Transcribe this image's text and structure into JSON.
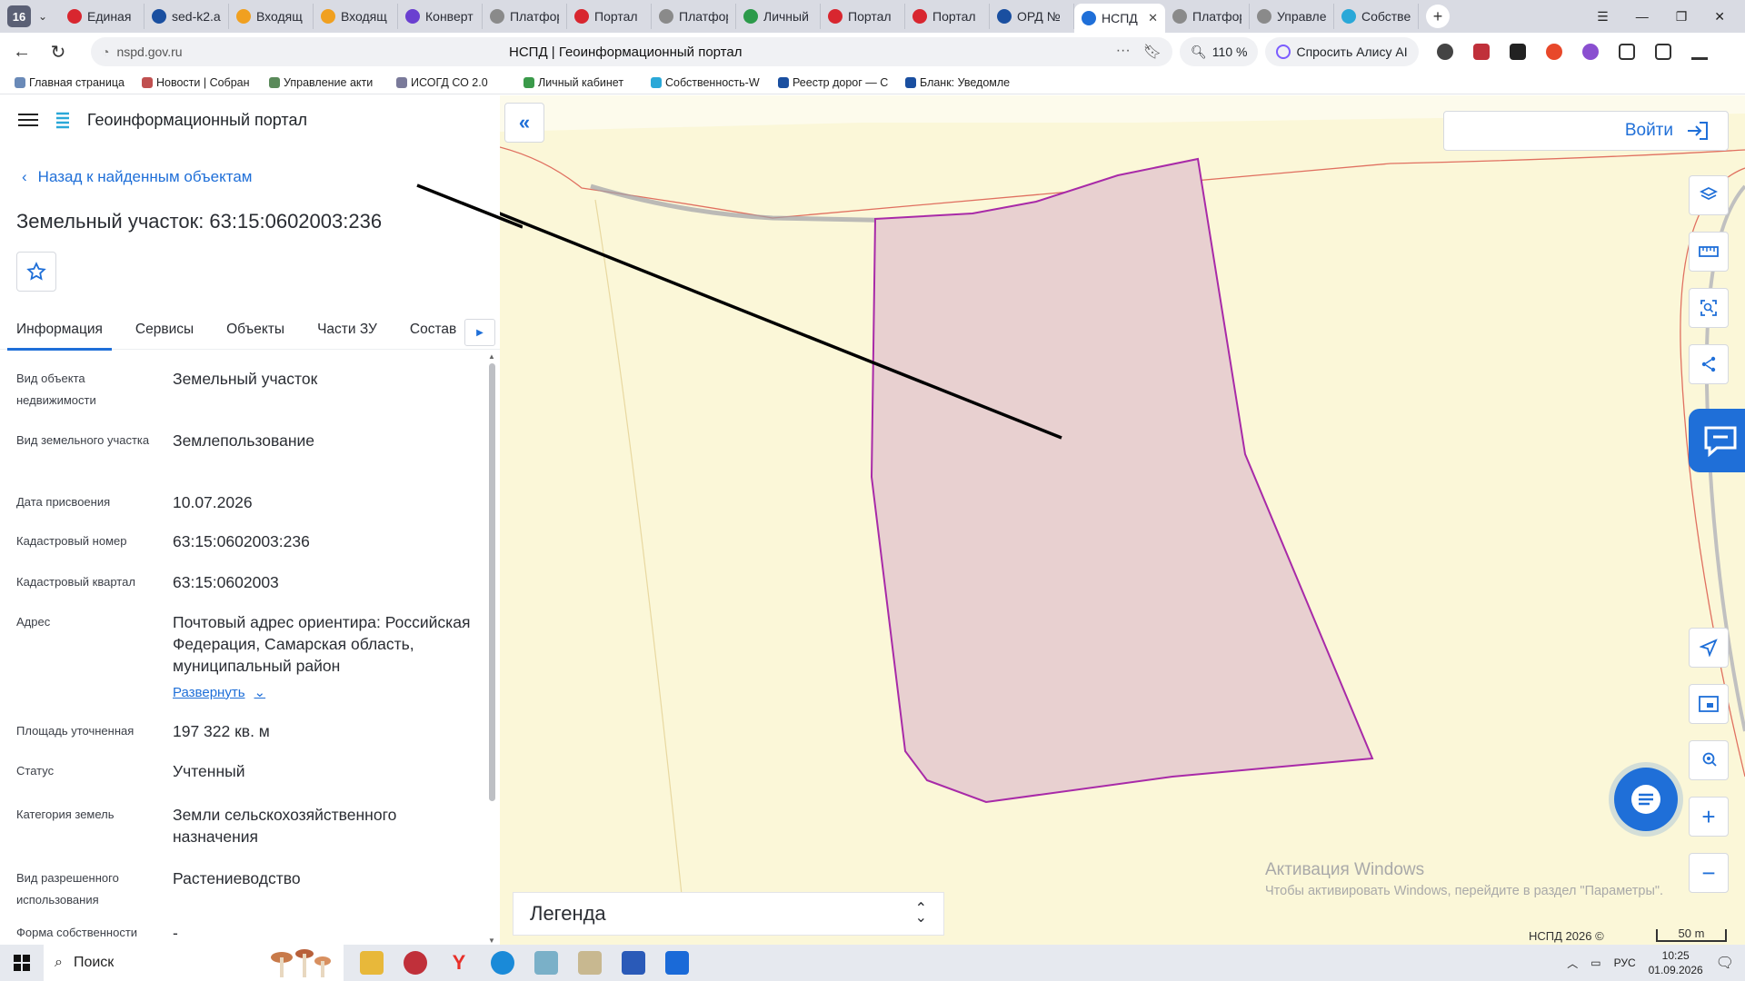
{
  "browser": {
    "tab_count": "16",
    "tabs": [
      {
        "label": "Единая",
        "color": "#d8262f"
      },
      {
        "label": "sed-k2.a",
        "color": "#1a4fa0"
      },
      {
        "label": "Входящ",
        "color": "#f0a020"
      },
      {
        "label": "Входящ",
        "color": "#f0a020"
      },
      {
        "label": "Конверт",
        "color": "#6a3fd0"
      },
      {
        "label": "Платфор",
        "color": "#8a8a8a"
      },
      {
        "label": "Портал",
        "color": "#d8262f"
      },
      {
        "label": "Платфор",
        "color": "#8a8a8a"
      },
      {
        "label": "Личный",
        "color": "#2c9a4a"
      },
      {
        "label": "Портал",
        "color": "#d8262f"
      },
      {
        "label": "Портал",
        "color": "#d8262f"
      },
      {
        "label": "ОРД №",
        "color": "#1a4fa0"
      },
      {
        "label": "НСПД",
        "color": "#1f6fd8",
        "active": true
      },
      {
        "label": "Платфор",
        "color": "#8a8a8a"
      },
      {
        "label": "Управле",
        "color": "#8a8a8a"
      },
      {
        "label": "Собстве",
        "color": "#2aa8d8"
      }
    ],
    "url": "nspd.gov.ru",
    "page_title": "НСПД | Геоинформационный портал",
    "zoom": "110 %",
    "alice_label": "Спросить Алису AI",
    "bookmarks": [
      "Главная страница",
      "Новости | Собран",
      "Управление акти",
      "ИСОГД СО 2.0",
      "Личный кабинет",
      "Собственность-W",
      "Реестр дорог — С",
      "Бланк: Уведомле"
    ]
  },
  "portal": {
    "name": "Геоинформационный портал",
    "back_link": "Назад к найденным объектам",
    "object_title": "Земельный участок: 63:15:0602003:236",
    "tabs": [
      "Информация",
      "Сервисы",
      "Объекты",
      "Части ЗУ",
      "Состав"
    ],
    "info": [
      {
        "label": "Вид объекта недвижимости",
        "value": "Земельный участок"
      },
      {
        "label": "Вид земельного участка",
        "value": "Землепользование"
      },
      {
        "label": "Дата присвоения",
        "value": "10.07.2026"
      },
      {
        "label": "Кадастровый номер",
        "value": "63:15:0602003:236"
      },
      {
        "label": "Кадастровый квартал",
        "value": "63:15:0602003"
      },
      {
        "label": "Адрес",
        "value": "Почтовый адрес ориентира: Российская Федерация, Самарская область, муниципальный район"
      },
      {
        "label": "Площадь уточненная",
        "value": "197 322 кв. м"
      },
      {
        "label": "Статус",
        "value": "Учтенный"
      },
      {
        "label": "Категория земель",
        "value": "Земли сельскохозяйственного назначения"
      },
      {
        "label": "Вид разрешенного использования",
        "value": "Растениеводство"
      },
      {
        "label": "Форма собственности",
        "value": "-"
      }
    ],
    "expand_label": "Развернуть"
  },
  "map": {
    "login_label": "Войти",
    "legend_label": "Легенда",
    "watermark_title": "Активация Windows",
    "watermark_text": "Чтобы активировать Windows, перейдите в раздел \"Параметры\".",
    "attribution": "НСПД 2026 ©",
    "scale_label": "50 m",
    "colors": {
      "background": "#fbf7d8",
      "parcel_fill": "#e8d0d0",
      "parcel_stroke": "#a82aa8",
      "accent": "#1f6fd8"
    }
  },
  "taskbar": {
    "search_label": "Поиск",
    "lang": "РУС",
    "time": "10:25",
    "date": "01.09.2026"
  }
}
